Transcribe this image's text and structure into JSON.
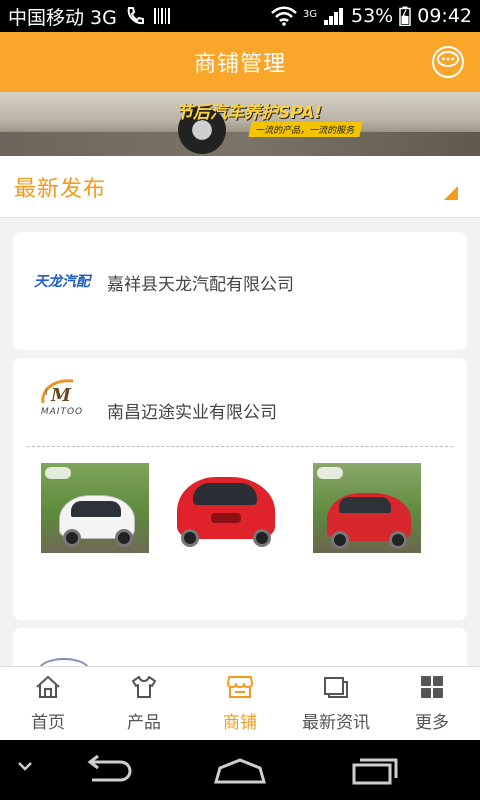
{
  "status_bar": {
    "carrier": "中国移动 3G",
    "network": "3G",
    "battery": "53%",
    "time": "09:42",
    "icons": [
      "phone-icon",
      "barcode-icon",
      "wifi-icon",
      "signal-icon",
      "battery-icon"
    ]
  },
  "header": {
    "title": "商铺管理",
    "message_icon": "chat-bubble-icon"
  },
  "banner": {
    "slogan": "节后汽车养护SPA!",
    "subtitle": "一流的产品，一流的服务"
  },
  "section": {
    "title": "最新发布"
  },
  "stores": [
    {
      "logo_text": "天龙汽配",
      "name": "嘉祥县天龙汽配有限公司"
    },
    {
      "logo_text": "MAITOO",
      "name": "南昌迈途实业有限公司",
      "photos": [
        "white-car-photo",
        "red-car-photo",
        "red-suv-photo"
      ]
    }
  ],
  "tabs": [
    {
      "label": "首页",
      "icon": "home-icon",
      "active": false
    },
    {
      "label": "产品",
      "icon": "shirt-icon",
      "active": false
    },
    {
      "label": "商铺",
      "icon": "store-icon",
      "active": true
    },
    {
      "label": "最新资讯",
      "icon": "news-icon",
      "active": false
    },
    {
      "label": "更多",
      "icon": "grid-icon",
      "active": false
    }
  ],
  "colors": {
    "brand": "#f9a62a",
    "accent": "#f39a1f",
    "background": "#f2f2f2"
  }
}
